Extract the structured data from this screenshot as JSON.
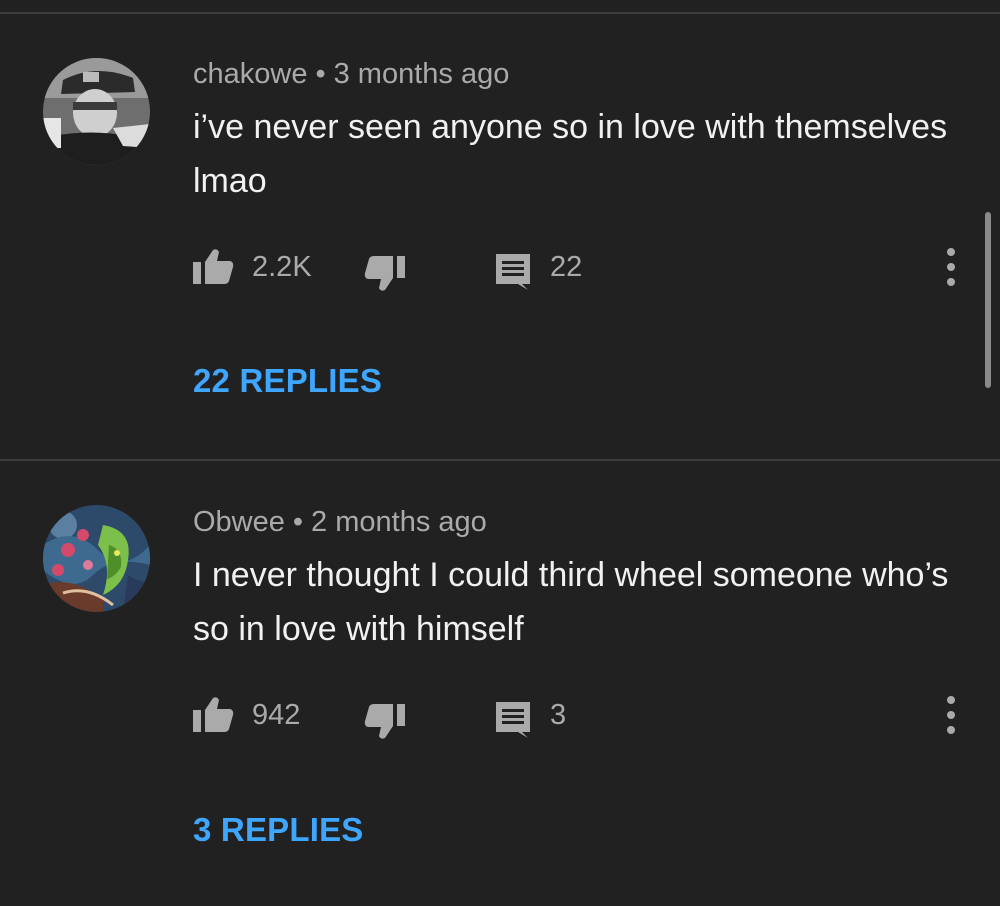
{
  "comments": [
    {
      "author": "chakowe",
      "separator": "•",
      "time": "3 months ago",
      "text": "i’ve never seen anyone so in love with themselves lmao",
      "likes": "2.2K",
      "reply_count": "22",
      "replies_label": "22 REPLIES",
      "avatar_icon": "grayscale-photo-avatar"
    },
    {
      "author": "Obwee",
      "separator": "•",
      "time": "2 months ago",
      "text": "I never thought I could third wheel someone who’s so in love with himself",
      "likes": "942",
      "reply_count": "3",
      "replies_label": "3 REPLIES",
      "avatar_icon": "colorful-art-avatar"
    }
  ],
  "icons": {
    "like": "thumbs-up-icon",
    "dislike": "thumbs-down-icon",
    "reply": "comment-icon",
    "more": "more-vertical-icon"
  },
  "colors": {
    "background": "#212121",
    "divider": "#3d3d3d",
    "primary_text": "#f1f1f1",
    "secondary_text": "#aaaaaa",
    "link": "#3ea6ff"
  }
}
